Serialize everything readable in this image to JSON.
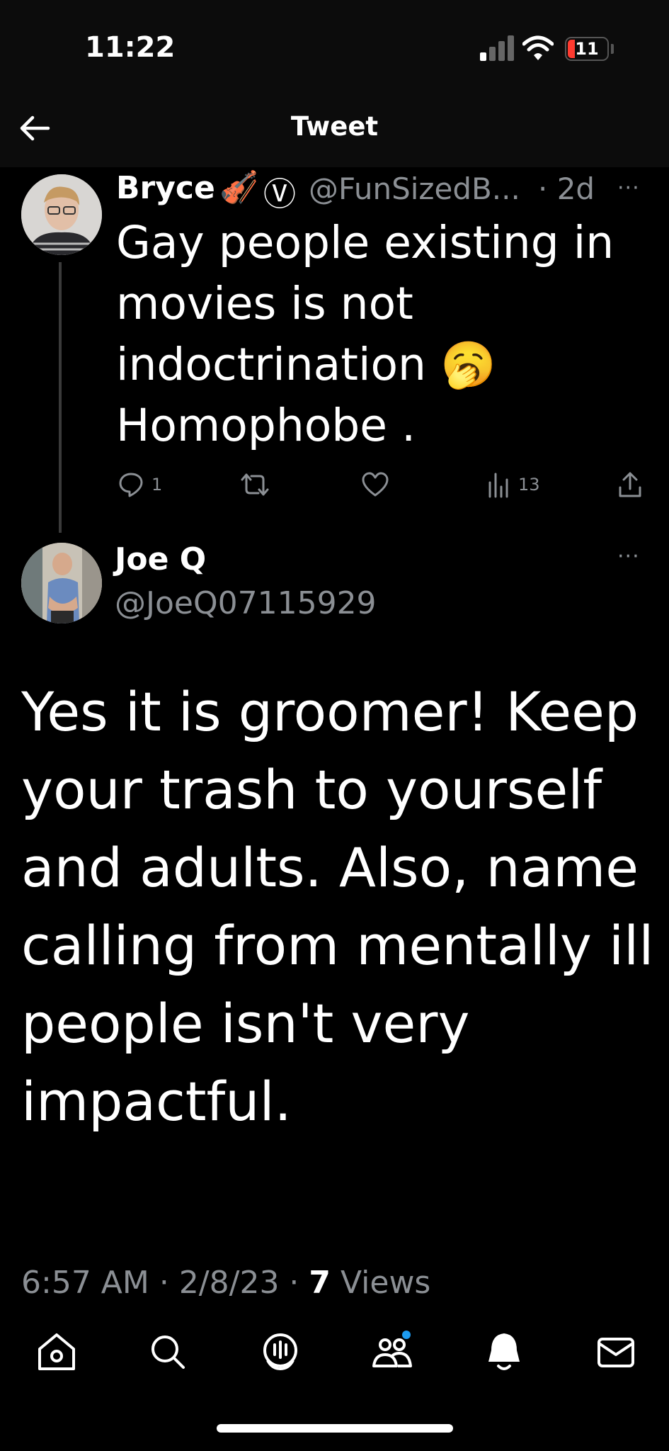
{
  "status_bar": {
    "time": "11:22",
    "battery": "11"
  },
  "header": {
    "title": "Tweet",
    "back_icon": "arrow-left-icon"
  },
  "parent_tweet": {
    "name": "Bryce",
    "name_emojis": "🎻",
    "verified_badge": "Ⓥ",
    "handle": "@FunSizedB...",
    "time": "· 2d",
    "more": "···",
    "text": "Gay people existing in movies is not indoctrination 🥱 Homophobe .",
    "reply_count": "1",
    "views_count": "13"
  },
  "reply": {
    "name": "Joe Q",
    "handle": "@JoeQ07115929",
    "more": "···",
    "text": "Yes it is groomer! Keep your trash to yourself and adults. Also, name calling from mentally ill people isn't very impactful.",
    "time": "6:57 AM · 2/8/23 · ",
    "views_count": "7",
    "views_label": " Views"
  },
  "tabbar": {
    "items": [
      "home-icon",
      "search-icon",
      "spaces-icon",
      "communities-icon",
      "notifications-icon",
      "messages-icon"
    ]
  },
  "colors": {
    "background": "#000000",
    "secondary_text": "#8b8f94",
    "accent": "#1d9bf0",
    "battery_low": "#ff3b30"
  }
}
